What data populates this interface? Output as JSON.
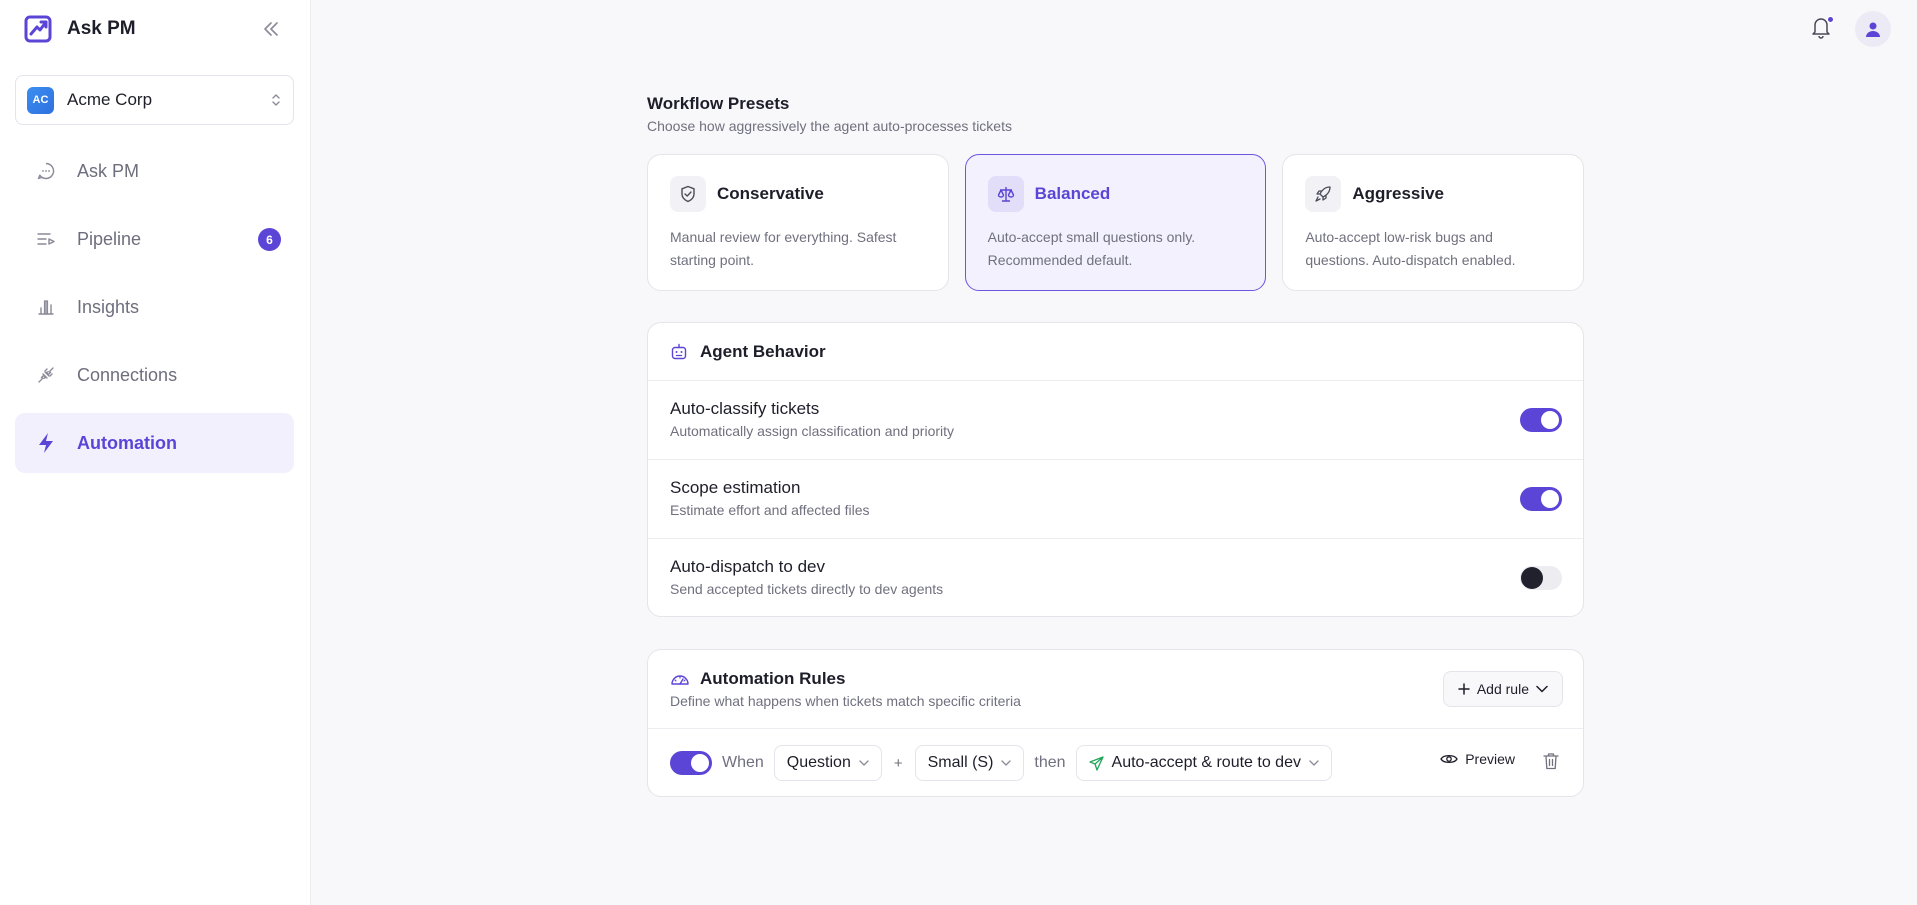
{
  "app": {
    "title": "Ask PM"
  },
  "org": {
    "badge": "AC",
    "name": "Acme Corp"
  },
  "nav": {
    "items": [
      {
        "label": "Ask PM",
        "icon": "chat-bubble-icon"
      },
      {
        "label": "Pipeline",
        "icon": "pipeline-list-icon",
        "badge": "6"
      },
      {
        "label": "Insights",
        "icon": "bar-chart-icon"
      },
      {
        "label": "Connections",
        "icon": "plug-icon"
      },
      {
        "label": "Automation",
        "icon": "lightning-icon",
        "active": true
      }
    ]
  },
  "colors": {
    "accent": "#5b45d6",
    "selected_bg": "#f3f1fd",
    "text": "#1e1e2a",
    "muted": "#70707e",
    "green": "#22a65a"
  },
  "presets": {
    "title": "Workflow Presets",
    "subtitle": "Choose how aggressively the agent auto-processes tickets",
    "items": [
      {
        "name": "Conservative",
        "desc": "Manual review for everything. Safest starting point.",
        "icon": "shield-check-icon",
        "selected": false
      },
      {
        "name": "Balanced",
        "desc": "Auto-accept small questions only. Recommended default.",
        "icon": "scale-icon",
        "selected": true
      },
      {
        "name": "Aggressive",
        "desc": "Auto-accept low-risk bugs and questions. Auto-dispatch enabled.",
        "icon": "rocket-icon",
        "selected": false
      }
    ]
  },
  "behavior": {
    "title": "Agent Behavior",
    "rows": [
      {
        "title": "Auto-classify tickets",
        "sub": "Automatically assign classification and priority",
        "enabled": true
      },
      {
        "title": "Scope estimation",
        "sub": "Estimate effort and affected files",
        "enabled": true
      },
      {
        "title": "Auto-dispatch to dev",
        "sub": "Send accepted tickets directly to dev agents",
        "enabled": false
      }
    ]
  },
  "rules": {
    "title": "Automation Rules",
    "subtitle": "Define what happens when tickets match specific criteria",
    "add_label": "Add rule",
    "items": [
      {
        "enabled": true,
        "when_label": "When",
        "type": "Question",
        "plus": "+",
        "size": "Small (S)",
        "then_label": "then",
        "action": "Auto-accept & route to dev",
        "preview_label": "Preview"
      }
    ]
  }
}
